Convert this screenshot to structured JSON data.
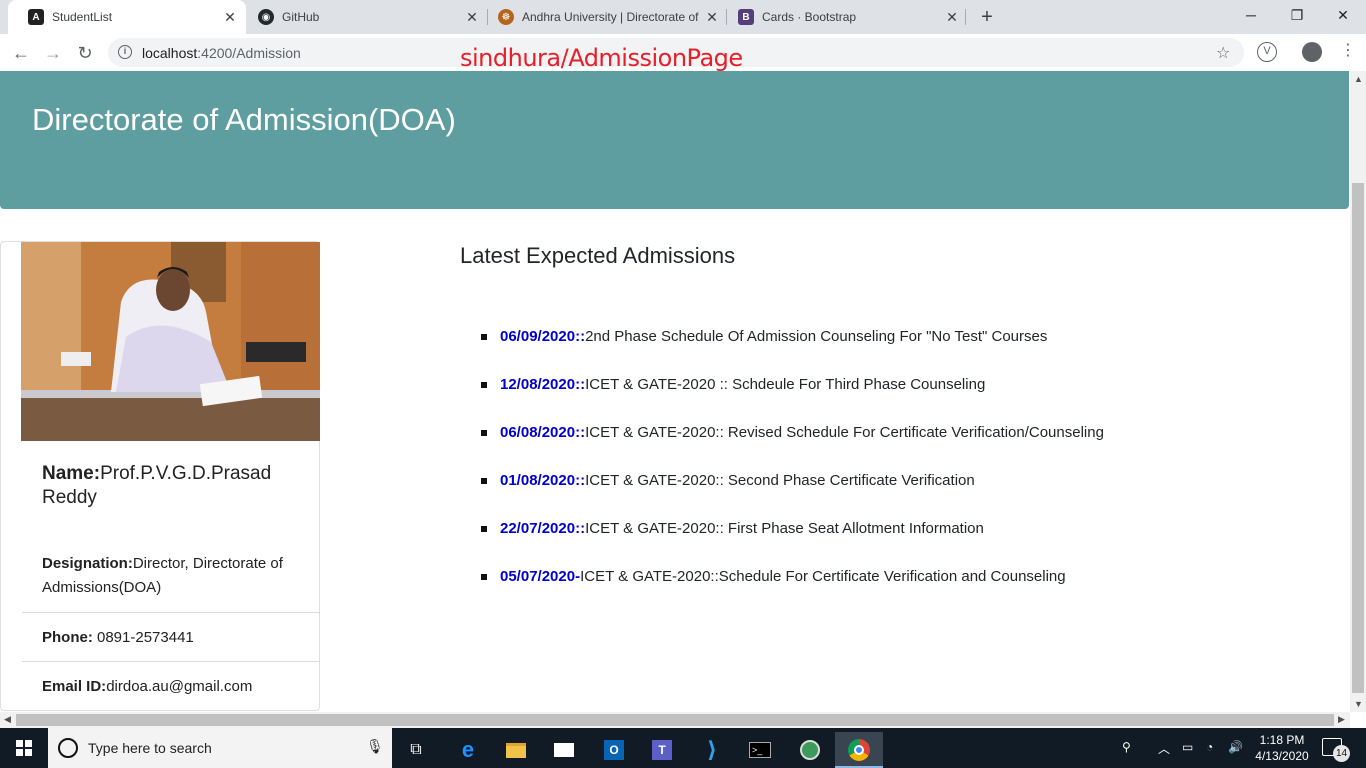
{
  "browser": {
    "tabs": [
      {
        "title": "StudentList",
        "active": true
      },
      {
        "title": "GitHub",
        "active": false
      },
      {
        "title": "Andhra University | Directorate of",
        "active": false
      },
      {
        "title": "Cards · Bootstrap",
        "active": false
      }
    ],
    "url_host": "localhost",
    "url_path": ":4200/Admission",
    "overlay_caption": "sindhura/AdmissionPage"
  },
  "page": {
    "heading": "Directorate of Admission(DOA)",
    "profile": {
      "name_label": "Name:",
      "name_value": "Prof.P.V.G.D.Prasad Reddy",
      "designation_label": "Designation:",
      "designation_value": "Director, Directorate of Admissions(DOA)",
      "phone_label": "Phone: ",
      "phone_value": "0891-2573441",
      "email_label": "Email ID:",
      "email_value": "dirdoa.au@gmail.com"
    },
    "admissions_title": "Latest Expected Admissions",
    "admissions": [
      {
        "date": "06/09/2020::",
        "text": "2nd Phase Schedule Of Admission Counseling For \"No Test\" Courses"
      },
      {
        "date": "12/08/2020::",
        "text": "ICET & GATE-2020 :: Schdeule For Third Phase Counseling"
      },
      {
        "date": "06/08/2020::",
        "text": "ICET & GATE-2020:: Revised Schedule For Certificate Verification/Counseling"
      },
      {
        "date": "01/08/2020::",
        "text": "ICET & GATE-2020:: Second Phase Certificate Verification"
      },
      {
        "date": "22/07/2020::",
        "text": "ICET & GATE-2020:: First Phase Seat Allotment Information"
      },
      {
        "date": "05/07/2020-",
        "text": "ICET & GATE-2020::Schedule For Certificate Verification and Counseling"
      }
    ]
  },
  "taskbar": {
    "search_placeholder": "Type here to search",
    "time": "1:18 PM",
    "date": "4/13/2020",
    "notification_count": "14"
  },
  "colors": {
    "jumbotron": "#5f9ea0",
    "date_link": "#0000cd",
    "caption": "#e5202a"
  }
}
